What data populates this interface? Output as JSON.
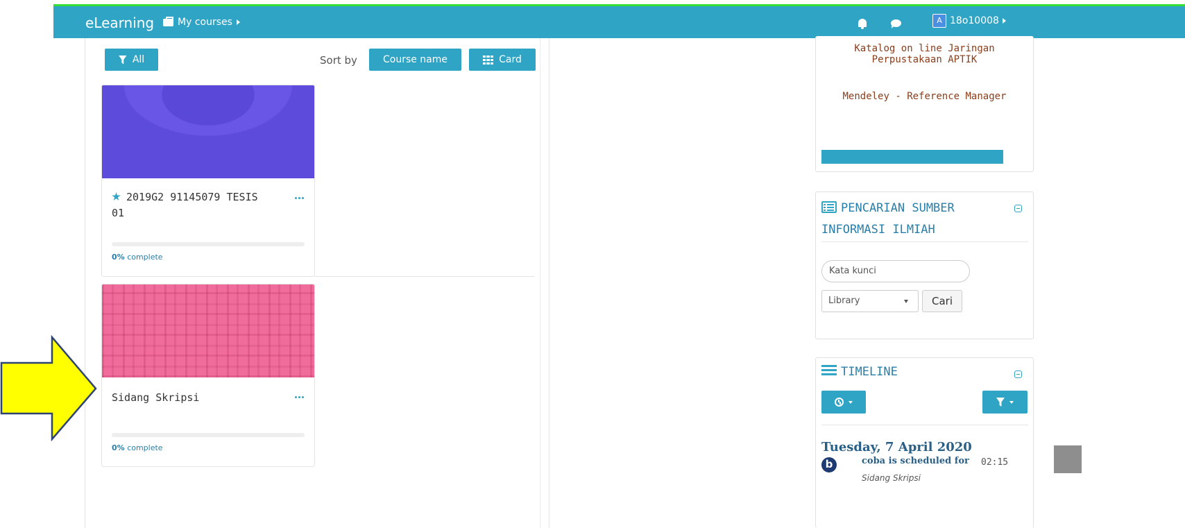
{
  "navbar": {
    "brand": "eLearning",
    "mycourses_label": "My courses",
    "user_initial": "A",
    "user_id": "18o10008",
    "accent_color": "#2fa4c4"
  },
  "courses": {
    "filter_label": "All",
    "sortby_label": "Sort by",
    "sort_value": "Course name",
    "view_label": "Card",
    "items": [
      {
        "title_line1": "2019G2 91145079 TESIS",
        "title_line2": "01",
        "starred": true,
        "progress_value": "0%",
        "progress_suffix": "complete",
        "image": "purple-pattern"
      },
      {
        "title_line1": "Sidang Skripsi",
        "title_line2": "",
        "starred": false,
        "progress_value": "0%",
        "progress_suffix": "complete",
        "image": "pink-plaid"
      }
    ]
  },
  "links_block": {
    "links": [
      "Katalog on line Jaringan",
      "Perpustakaan APTIK",
      "Mendeley - Reference Manager"
    ]
  },
  "search_block": {
    "title_line1": "PENCARIAN SUMBER",
    "title_line2": "INFORMASI ILMIAH",
    "search_placeholder": "Kata kunci",
    "select_value": "Library",
    "submit_label": "Cari"
  },
  "timeline_block": {
    "title": "TIMELINE",
    "date": "Tuesday, 7 April 2020",
    "event_icon_letter": "b",
    "event_text": "coba is scheduled for",
    "event_time": "02:15",
    "event_course": "Sidang Skripsi"
  }
}
